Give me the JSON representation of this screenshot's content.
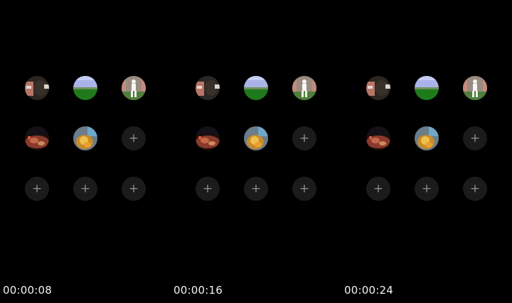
{
  "frames": [
    {
      "timestamp": "00:00:08",
      "slots": [
        {
          "type": "thumb",
          "icon": "person-photo-icon"
        },
        {
          "type": "thumb",
          "icon": "sky-field-photo-icon"
        },
        {
          "type": "thumb",
          "icon": "white-figure-photo-icon"
        },
        {
          "type": "thumb",
          "icon": "red-food-photo-icon"
        },
        {
          "type": "thumb",
          "icon": "fire-photo-icon"
        },
        {
          "type": "add",
          "label": "+"
        },
        {
          "type": "add",
          "label": "+"
        },
        {
          "type": "add",
          "label": "+"
        },
        {
          "type": "add",
          "label": "+"
        }
      ]
    },
    {
      "timestamp": "00:00:16",
      "slots": [
        {
          "type": "thumb",
          "icon": "person-photo-icon"
        },
        {
          "type": "thumb",
          "icon": "sky-field-photo-icon"
        },
        {
          "type": "thumb",
          "icon": "white-figure-photo-icon"
        },
        {
          "type": "thumb",
          "icon": "red-food-photo-icon"
        },
        {
          "type": "thumb",
          "icon": "fire-photo-icon"
        },
        {
          "type": "add",
          "label": "+"
        },
        {
          "type": "add",
          "label": "+"
        },
        {
          "type": "add",
          "label": "+"
        },
        {
          "type": "add",
          "label": "+"
        }
      ]
    },
    {
      "timestamp": "00:00:24",
      "slots": [
        {
          "type": "thumb",
          "icon": "person-photo-icon"
        },
        {
          "type": "thumb",
          "icon": "sky-field-photo-icon"
        },
        {
          "type": "thumb",
          "icon": "white-figure-photo-icon"
        },
        {
          "type": "thumb",
          "icon": "red-food-photo-icon"
        },
        {
          "type": "thumb",
          "icon": "fire-photo-icon"
        },
        {
          "type": "add",
          "label": "+"
        },
        {
          "type": "add",
          "label": "+"
        },
        {
          "type": "add",
          "label": "+"
        },
        {
          "type": "add",
          "label": "+"
        }
      ]
    }
  ],
  "colors": {
    "background": "#000000",
    "empty_slot": "#1b1b1b",
    "plus_glyph": "#8c8c8c",
    "timestamp_text": "#f2f2f2"
  }
}
